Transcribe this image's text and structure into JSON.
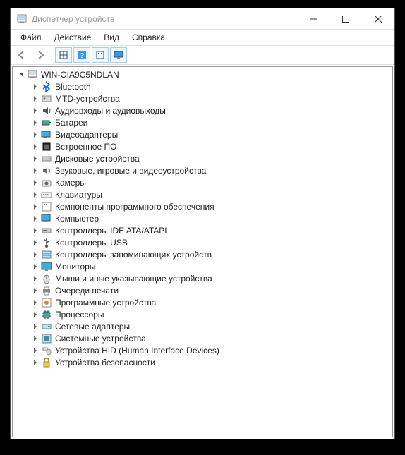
{
  "window": {
    "title": "Диспетчер устройств"
  },
  "menu": {
    "file": "Файл",
    "action": "Действие",
    "view": "Вид",
    "help": "Справка"
  },
  "tree": {
    "root": "WIN-OIA9C5NDLAN",
    "items": [
      {
        "label": "Bluetooth",
        "icon": "bluetooth"
      },
      {
        "label": "MTD-устройства",
        "icon": "mtd"
      },
      {
        "label": "Аудиовходы и аудиовыходы",
        "icon": "audio"
      },
      {
        "label": "Батареи",
        "icon": "battery"
      },
      {
        "label": "Видеоадаптеры",
        "icon": "display-adapter"
      },
      {
        "label": "Встроенное ПО",
        "icon": "firmware"
      },
      {
        "label": "Дисковые устройства",
        "icon": "disk"
      },
      {
        "label": "Звуковые, игровые и видеоустройства",
        "icon": "sound"
      },
      {
        "label": "Камеры",
        "icon": "camera"
      },
      {
        "label": "Клавиатуры",
        "icon": "keyboard"
      },
      {
        "label": "Компоненты программного обеспечения",
        "icon": "software"
      },
      {
        "label": "Компьютер",
        "icon": "computer"
      },
      {
        "label": "Контроллеры IDE ATA/ATAPI",
        "icon": "ide"
      },
      {
        "label": "Контроллеры USB",
        "icon": "usb"
      },
      {
        "label": "Контроллеры запоминающих устройств",
        "icon": "storage-ctrl"
      },
      {
        "label": "Мониторы",
        "icon": "monitor"
      },
      {
        "label": "Мыши и иные указывающие устройства",
        "icon": "mouse"
      },
      {
        "label": "Очереди печати",
        "icon": "printer"
      },
      {
        "label": "Программные устройства",
        "icon": "software-device"
      },
      {
        "label": "Процессоры",
        "icon": "cpu"
      },
      {
        "label": "Сетевые адаптеры",
        "icon": "network"
      },
      {
        "label": "Системные устройства",
        "icon": "system"
      },
      {
        "label": "Устройства HID (Human Interface Devices)",
        "icon": "hid"
      },
      {
        "label": "Устройства безопасности",
        "icon": "security"
      }
    ]
  }
}
